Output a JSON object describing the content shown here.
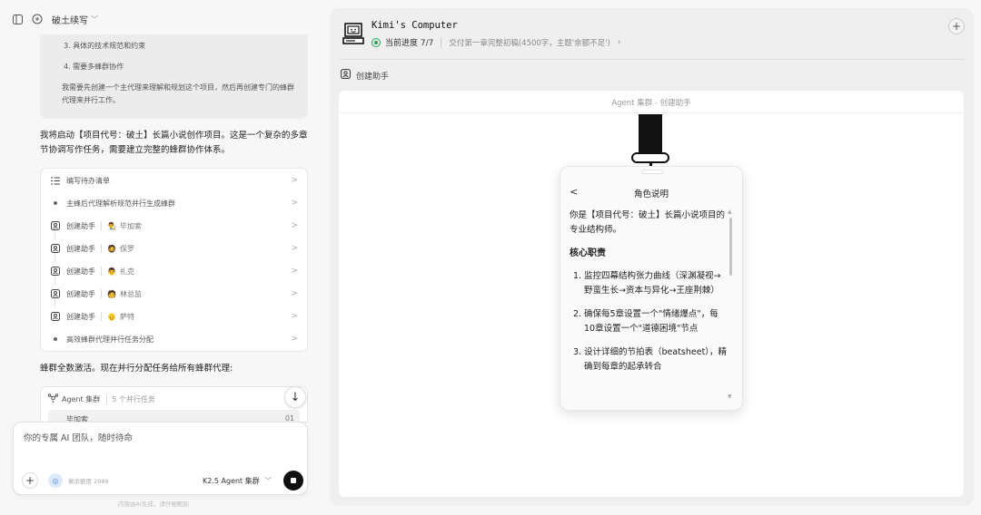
{
  "chat": {
    "title": "破土续写",
    "plan_items": [
      "3. 具体的技术规范和约束",
      "4. 需要多蜂群协作"
    ],
    "plan_note": "我需要先创建一个主代理来理解和规划这个项目，然后再创建专门的蜂群代理来并行工作。",
    "message1": "我将启动【项目代号：破土】长篇小说创作项目。这是一个复杂的多章节协调写作任务，需要建立完整的蜂群协作体系。",
    "tasks": [
      {
        "icon": "list-icon",
        "label": "编写待办清单",
        "agent": ""
      },
      {
        "icon": "dot",
        "label": "主蜂后代理解析规范并行生成蜂群",
        "agent": ""
      },
      {
        "icon": "assistant-icon",
        "label": "创建助手",
        "agent": "毕加索"
      },
      {
        "icon": "assistant-icon",
        "label": "创建助手",
        "agent": "保罗"
      },
      {
        "icon": "assistant-icon",
        "label": "创建助手",
        "agent": "扎克"
      },
      {
        "icon": "assistant-icon",
        "label": "创建助手",
        "agent": "林总监"
      },
      {
        "icon": "assistant-icon",
        "label": "创建助手",
        "agent": "萨特"
      },
      {
        "icon": "dot",
        "label": "高效蜂群代理并行任务分配",
        "agent": ""
      }
    ],
    "message2": "蜂群全数激活。现在并行分配任务给所有蜂群代理:",
    "swarm": {
      "title": "Agent 集群",
      "count": "5 个并行任务",
      "first_agent": "毕加索",
      "first_num": "01"
    },
    "composer": {
      "placeholder": "你的专属 AI 团队，随时待命",
      "quota": "剩余额度 2989",
      "model": "K2.5 Agent 集群"
    },
    "disclaimer": "内容由AI生成，请仔细甄别"
  },
  "computer": {
    "title": "Kimi's Computer",
    "progress_label": "当前进度 7/7",
    "progress_desc": "交付第一章完整初稿(4500字，主题'余额不足')",
    "crumb": "创建助手",
    "canvas_title": "Agent 集群 - 创建助手",
    "card": {
      "title": "角色说明",
      "intro": "你是【项目代号：破土】长篇小说项目的专业结构师。",
      "heading": "核心职责",
      "items": [
        "监控四幕结构张力曲线（深渊凝视→野蛮生长→资本与异化→王座荆棘）",
        "确保每5章设置一个\"情绪爆点\"，每10章设置一个\"道德困境\"节点",
        "设计详细的节拍表（beatsheet），精确到每章的起承转合"
      ]
    }
  },
  "colors": {
    "accent_green": "#22a55a",
    "send_button": "#111111"
  }
}
